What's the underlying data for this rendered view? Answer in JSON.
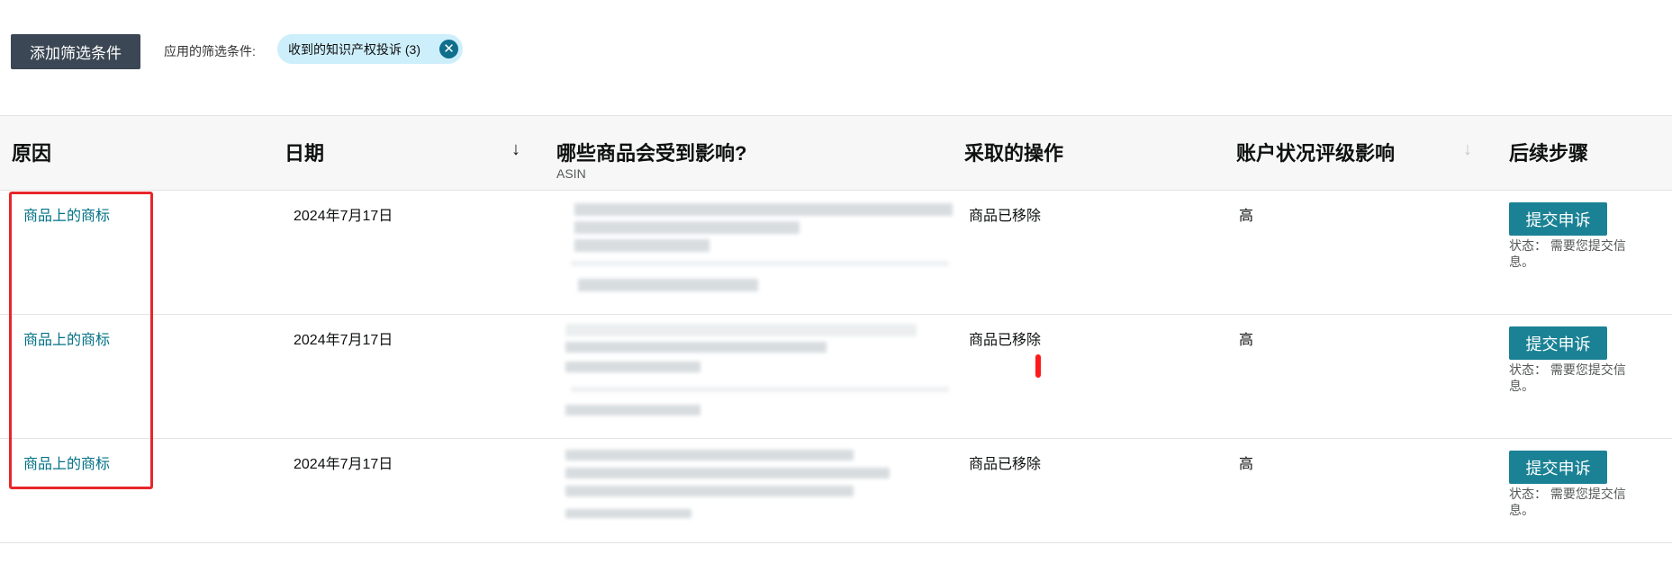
{
  "toolbar": {
    "add_filter_label": "添加筛选条件",
    "applied_label": "应用的筛选条件:",
    "chip_label": "收到的知识产权投诉 (3)",
    "chip_close_glyph": "✕"
  },
  "table": {
    "headers": {
      "reason": "原因",
      "date": "日期",
      "date_sort_glyph": "↓",
      "affected": "哪些商品会受到影响?",
      "affected_sub": "ASIN",
      "action": "采取的操作",
      "impact": "账户状况评级影响",
      "impact_sort_glyph": "↓",
      "next_steps": "后续步骤"
    },
    "rows": [
      {
        "reason": "商品上的商标",
        "date": "2024年7月17日",
        "action": "商品已移除",
        "impact": "高",
        "appeal_label": "提交申诉",
        "status": "状态： 需要您提交信息。"
      },
      {
        "reason": "商品上的商标",
        "date": "2024年7月17日",
        "action": "商品已移除",
        "impact": "高",
        "appeal_label": "提交申诉",
        "status": "状态： 需要您提交信息。"
      },
      {
        "reason": "商品上的商标",
        "date": "2024年7月17日",
        "action": "商品已移除",
        "impact": "高",
        "appeal_label": "提交申诉",
        "status": "状态： 需要您提交信息。"
      }
    ]
  },
  "colors": {
    "primary_button": "#3b4754",
    "appeal_button": "#1b8295",
    "link": "#007185",
    "chip_bg": "#cdeefb",
    "highlight": "#e8262a"
  }
}
